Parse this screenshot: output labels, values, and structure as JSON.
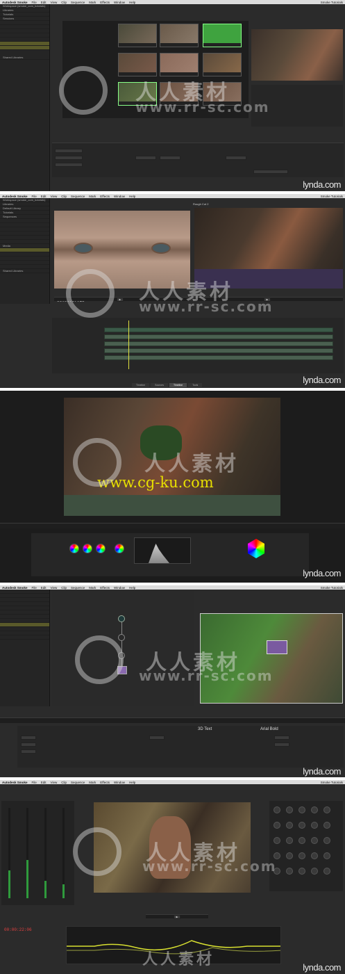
{
  "menu": {
    "app_name": "Autodesk Smoke",
    "items": [
      "File",
      "Edit",
      "View",
      "Clip",
      "Sequence",
      "Mark",
      "Effects",
      "Window",
      "Help"
    ],
    "right_title": "Smoke Tutorials"
  },
  "panel1": {
    "sidebar": [
      "Workspace (smoke_com_tutorials)",
      "Libraries",
      "Tutorials",
      "Sessions",
      "",
      "",
      "",
      "",
      "",
      "",
      "",
      "",
      "",
      "",
      "Shared Libraries"
    ]
  },
  "panel2": {
    "sidebar": [
      "Workspace (smoke_com_tutorials)",
      "Libraries",
      "Default Library",
      "Tutorials",
      "Sequences",
      "",
      "",
      "",
      "",
      "",
      "",
      "Media",
      "",
      "",
      "",
      "",
      "",
      "",
      "",
      "Shared Libraries"
    ],
    "left_timecode": "00:00:07:18",
    "right_viewer_title": "Rough Cut 2",
    "tabs": [
      "Timeline",
      "Sources",
      "Timeline",
      "Tools"
    ]
  },
  "panel3": {
    "watermark_url": "www.cg-ku.com"
  },
  "panel4": {
    "text_label": "3D Text",
    "font_label": "Arial Bold"
  },
  "panel5": {
    "timecode": "00:00:22:06"
  },
  "watermark": {
    "text": "人人素材",
    "url": "www.rr-sc.com"
  },
  "branding": {
    "lynda": "lynda.com"
  },
  "colors": {
    "bg": "#2b2b2b",
    "menubar": "#dcdcdc",
    "accent_green": "#2f9a3c",
    "highlight": "#5a5a2a",
    "cgku_yellow": "#e8e000"
  }
}
